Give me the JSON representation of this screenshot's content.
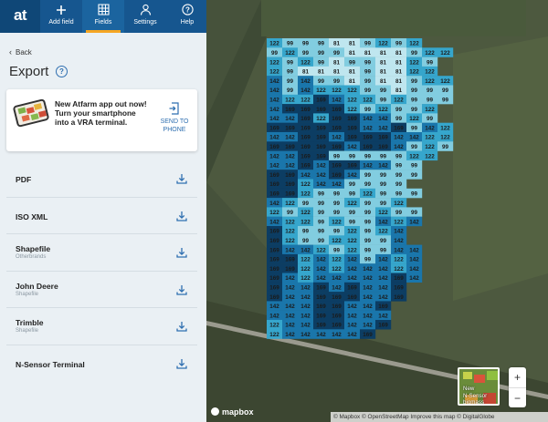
{
  "nav": {
    "logo": "at",
    "items": [
      {
        "label": "Add field",
        "icon": "plus-icon"
      },
      {
        "label": "Fields",
        "icon": "grid-icon",
        "active": true
      },
      {
        "label": "Settings",
        "icon": "user-icon"
      },
      {
        "label": "Help",
        "icon": "question-icon"
      }
    ],
    "colors": {
      "bar": "#16568f",
      "active_underline": "#f5a623"
    }
  },
  "back_label": "Back",
  "page_title": "Export",
  "help_glyph": "?",
  "promo": {
    "text": "New Atfarm app out now! Turn your smartphone into a VRA terminal.",
    "send_label_1": "SEND TO",
    "send_label_2": "PHONE"
  },
  "exports": [
    {
      "name": "PDF",
      "sub": ""
    },
    {
      "name": "ISO XML",
      "sub": ""
    },
    {
      "name": "Shapefile",
      "sub": "Otherbrands"
    },
    {
      "name": "John Deere",
      "sub": "Shapefile"
    },
    {
      "name": "Trimble",
      "sub": "Shapefile"
    },
    {
      "name": "N-Sensor Terminal",
      "sub": ""
    }
  ],
  "map": {
    "grid_rows": [
      "122 99 99 99 81 81 99 122 99 122",
      "99 122 99 99 99 81 81 81 81 99 122 122",
      "122 99 122 99 81 99 99 81 81 122 99",
      "122 99 81 81 81 81 99 81 81 122 122",
      "142 99 142 99 99 81 99 81 81 99 122 122",
      "142 99 142 122 122 122 99 99 81 99 99 99",
      "142 122 122 169 142 122 122 99 122 99 99 99",
      "142 169 169 169 169 122 99 122 99 99 122",
      "142 142 169 122 169 169 142 142 99 122 99",
      "169 169 169 169 169 169 142 142 169 99 142 122",
      "142 142 169 169 142 169 169 169 142 142 122 122",
      "169 169 169 169 169 142 169 169 142 99 122 99",
      "142 142 169 169 99 99 99 99 99 122 122",
      "142 142 169 142 169 169 142 142 99 99",
      "169 169 142 142 169 142 99 99 99 99",
      "169 169 122 142 142 99 99 99 99",
      "169 169 122 99 99 99 122 99 99 99",
      "142 122 99 99 99 122 99 99 122",
      "122 99 122 99 99 99 99 122 99 99",
      "142 122 122 99 122 99 99 142 122 142",
      "169 122 99 99 99 122 99 122 142",
      "169 122 99 99 122 122 99 99 142",
      "169 142 142 122 99 122 99 99 142 142",
      "169 169 122 142 122 142 99 142 122 142",
      "169 169 122 142 122 142 142 142 122 142",
      "169 142 122 142 142 142 142 142 169 142",
      "169 142 142 169 142 169 142 142 169",
      "169 142 142 169 169 169 142 142 169",
      "142 142 142 169 169 142 142 169",
      "142 142 142 169 169 142 142 142",
      "122 142 142 169 169 142 142 169",
      "122 142 142 142 142 142 169"
    ],
    "value_colors": {
      "81": "#bfe6ef",
      "99": "#82cde0",
      "122": "#36a6cc",
      "142": "#1a76ab",
      "169": "#0c3d63"
    },
    "legend_label_1": "New",
    "legend_label_2": "N-Sensor",
    "legend_label_3": "biomass",
    "zoom_in": "+",
    "zoom_out": "−",
    "brand": "mapbox",
    "attribution": "© Mapbox © OpenStreetMap Improve this map © DigitalGlobe"
  }
}
